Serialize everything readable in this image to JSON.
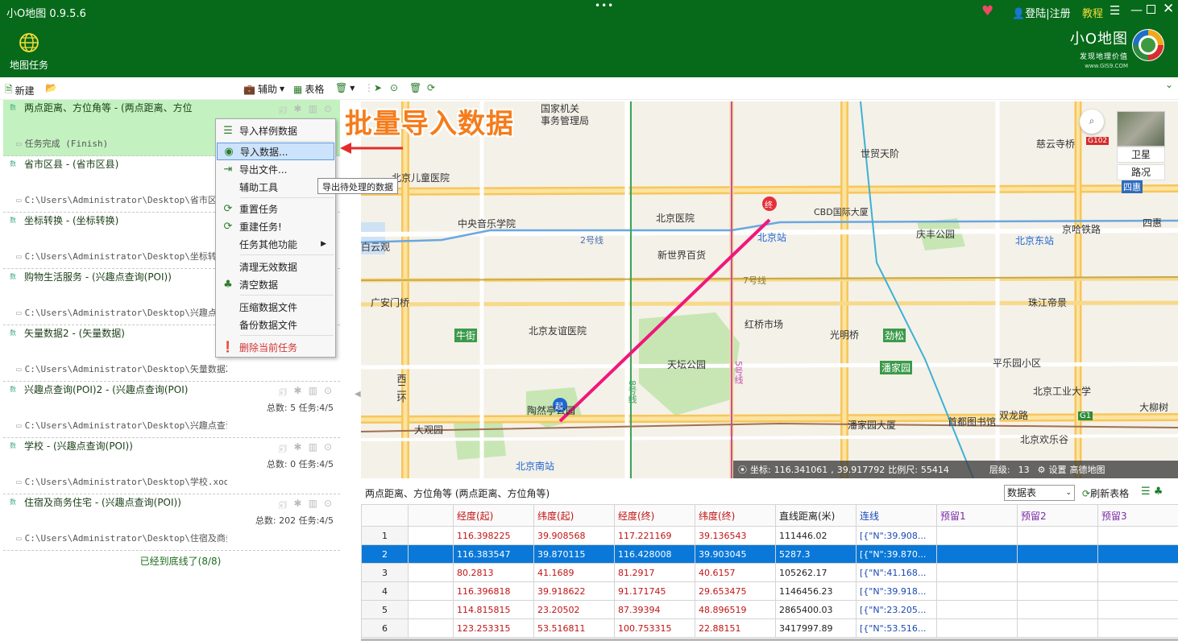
{
  "app": {
    "title": "小O地图 0.9.5.6",
    "drag": "•••",
    "login": "登陆|注册",
    "tutorial": "教程",
    "map_task_label": "地图任务",
    "brand_name": "小O地图",
    "brand_slogan": "发现地理价值",
    "brand_url": "www.GIS9.COM"
  },
  "toolbar": {
    "new_label": "新建",
    "assist_label": "辅助",
    "table_label": "表格"
  },
  "tasks": [
    {
      "name": "两点距离、方位角等 - (两点距离、方位",
      "status": "任务完成 (Finish)",
      "stats": ""
    },
    {
      "name": "省市区县 - (省市区县)",
      "path": "C:\\Users\\Administrator\\Desktop\\省市区县",
      "stats": ""
    },
    {
      "name": "坐标转换 - (坐标转换)",
      "path": "C:\\Users\\Administrator\\Desktop\\坐标转换",
      "stats": ""
    },
    {
      "name": "购物生活服务 - (兴趣点查询(POI))",
      "path": "C:\\Users\\Administrator\\Desktop\\兴趣点查",
      "stats": ""
    },
    {
      "name": "矢量数据2 - (矢量数据)",
      "path": "C:\\Users\\Administrator\\Desktop\\矢量数据2.xod",
      "stats": ""
    },
    {
      "name": "兴趣点查询(POI)2 - (兴趣点查询(POI)",
      "path": "C:\\Users\\Administrator\\Desktop\\兴趣点查询(POI)2.xod",
      "stats": "总数: 5 任务:4/5"
    },
    {
      "name": "学校 - (兴趣点查询(POI))",
      "path": "C:\\Users\\Administrator\\Desktop\\学校.xod",
      "stats": "总数: 0 任务:4/5"
    },
    {
      "name": "住宿及商务住宅 - (兴趣点查询(POI))",
      "path": "C:\\Users\\Administrator\\Desktop\\住宿及商务住宅.xod",
      "stats": "总数: 202 任务:4/5"
    }
  ],
  "list_end": "已经到底线了(8/8)",
  "context_menu": {
    "import_sample": "导入样例数据",
    "import_data": "导入数据...",
    "export_file": "导出文件...",
    "assist_tools": "辅助工具",
    "reset_task": "重置任务",
    "rebuild_task": "重建任务!",
    "more_functions": "任务其他功能",
    "clean_invalid": "清理无效数据",
    "clear_data": "清空数据",
    "compress_file": "压缩数据文件",
    "backup_file": "备份数据文件",
    "delete_task": "删除当前任务"
  },
  "tooltip": "导出待处理的数据",
  "callout": "批量导入数据",
  "map": {
    "satellite": "卫星",
    "traffic": "路况",
    "labels": [
      "国家机关",
      "事务管理局",
      "慈云寺桥",
      "G102",
      "世贸天阶",
      "北京儿童医院",
      "四惠",
      "中央音乐学院",
      "北京医院",
      "CBD国际大厦",
      "庆丰公园",
      "四惠",
      "北京站",
      "北京东站",
      "京哈铁路",
      "白云观",
      "2号线",
      "新世界百货",
      "7号线",
      "广安门桥",
      "珠江帝景",
      "牛街",
      "北京友谊医院",
      "红桥市场",
      "光明桥",
      "劲松",
      "天坛公园",
      "5号线",
      "潘家园",
      "平乐园小区",
      "西二环",
      "陶然亭公园",
      "北京工业大学",
      "大柳树",
      "大观园",
      "潘家园大厦",
      "首都图书馆",
      "双龙路",
      "G1",
      "北京南站",
      "北京欢乐谷",
      "8号线",
      "起",
      "终"
    ],
    "status": {
      "coord_label": "坐标:",
      "lng": "116.341061",
      "sep": ",",
      "lat": "39.917792",
      "scale_label": "比例尺:",
      "scale": "55414",
      "level_label": "层级:",
      "level": "13",
      "settings": "设置",
      "source": "高德地图"
    }
  },
  "data_panel": {
    "title": "两点距离、方位角等 (两点距离、方位角等)",
    "select_value": "数据表",
    "refresh_label": "刷新表格"
  },
  "table": {
    "headers": [
      "",
      "",
      "经度(起)",
      "纬度(起)",
      "经度(终)",
      "纬度(终)",
      "直线距离(米)",
      "连线",
      "预留1",
      "预留2",
      "预留3"
    ],
    "rows": [
      [
        "1",
        "",
        "116.398225",
        "39.908568",
        "117.221169",
        "39.136543",
        "111446.02",
        "[{\"N\":39.908..."
      ],
      [
        "2",
        "",
        "116.383547",
        "39.870115",
        "116.428008",
        "39.903045",
        "5287.3",
        "[{\"N\":39.870..."
      ],
      [
        "3",
        "",
        "80.2813",
        "41.1689",
        "81.2917",
        "40.6157",
        "105262.17",
        "[{\"N\":41.168..."
      ],
      [
        "4",
        "",
        "116.396818",
        "39.918622",
        "91.171745",
        "29.653475",
        "1146456.23",
        "[{\"N\":39.918..."
      ],
      [
        "5",
        "",
        "114.815815",
        "23.20502",
        "87.39394",
        "48.896519",
        "2865400.03",
        "[{\"N\":23.205..."
      ],
      [
        "6",
        "",
        "123.253315",
        "53.516811",
        "100.753315",
        "22.88151",
        "3417997.89",
        "[{\"N\":53.516..."
      ]
    ],
    "selected_row": 2
  },
  "colors": {
    "titlebar": "#066a1a",
    "selected_task": "#c3f2c0",
    "selected_row": "#0a78d8",
    "callout": "#f57c1c",
    "route_line": "#f0177c"
  }
}
